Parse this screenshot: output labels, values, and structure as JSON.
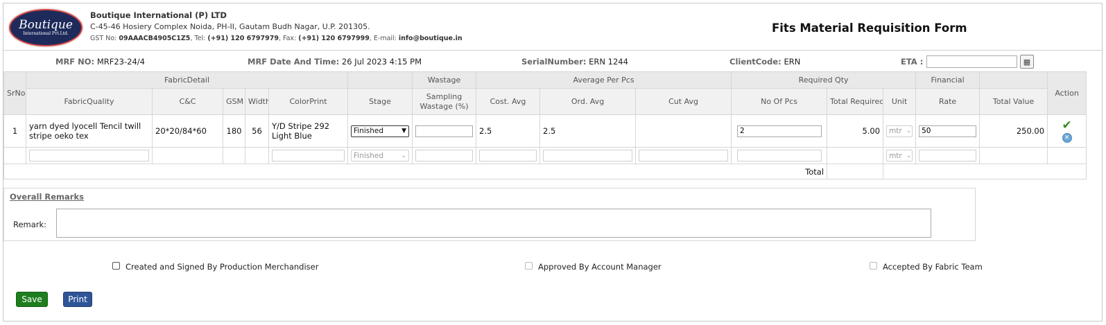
{
  "header": {
    "logo_text": "Boutique",
    "logo_subtext": "International Pvt.Ltd.",
    "company_name": "Boutique International (P) LTD",
    "address": "C-45-46 Hosiery Complex Noida, PH-II, Gautam Budh Nagar, U.P. 201305.",
    "gst_label": "GST No:",
    "gst_value": "09AAACB4905C1Z5",
    "tel_label": ", Tel:",
    "tel_value": "(+91) 120 6797979",
    "fax_label": ", Fax:",
    "fax_value": "(+91) 120 6797999",
    "email_label": ", E-mail:",
    "email_value": "info@boutique.in",
    "form_title": "Fits Material Requisition Form"
  },
  "meta": {
    "mrf_no_label": "MRF NO:",
    "mrf_no_value": "MRF23-24/4",
    "mrf_date_label": "MRF Date And Time:",
    "mrf_date_value": "26 Jul 2023 4:15 PM",
    "serial_label": "SerialNumber:",
    "serial_value": "ERN 1244",
    "client_label": "ClientCode:",
    "client_value": "ERN",
    "eta_label": "ETA :",
    "eta_value": ""
  },
  "table": {
    "group_headers": {
      "srno": "SrNo",
      "fabric_detail": "FabricDetail",
      "wastage": "Wastage",
      "average_per_pcs": "Average Per Pcs",
      "required_qty": "Required Qty",
      "financial": "Financial",
      "action": "Action"
    },
    "columns": {
      "fabric_quality": "FabricQuality",
      "cc": "C&C",
      "gsm": "GSM",
      "width": "Width",
      "color_print": "ColorPrint",
      "stage": "Stage",
      "sampling_wastage": "Sampling Wastage (%)",
      "cost_avg": "Cost. Avg",
      "ord_avg": "Ord. Avg",
      "cut_avg": "Cut Avg",
      "no_of_pcs": "No Of Pcs",
      "total_required": "Total Required",
      "unit": "Unit",
      "rate": "Rate",
      "total_value": "Total Value"
    },
    "row1": {
      "srno": "1",
      "fabric_quality": "yarn dyed lyocell Tencil twill stripe oeko tex",
      "cc": "20*20/84*60",
      "gsm": "180",
      "width": "56",
      "color_print": "Y/D Stripe 292 Light Blue",
      "stage": "Finished",
      "sampling_wastage": "",
      "cost_avg": "2.5",
      "ord_avg": "2.5",
      "cut_avg": "",
      "no_of_pcs": "2",
      "total_required": "5.00",
      "unit": "mtr",
      "rate": "50",
      "total_value": "250.00"
    },
    "row2": {
      "stage": "Finished",
      "unit": "mtr"
    },
    "total_label": "Total"
  },
  "remarks": {
    "title": "Overall Remarks",
    "remark_label": "Remark:",
    "remark_value": ""
  },
  "checkboxes": {
    "created": "Created and Signed By Production Merchandiser",
    "approved": "Approved By Account Manager",
    "accepted": "Accepted By Fabric Team"
  },
  "buttons": {
    "save": "Save",
    "print": "Print"
  },
  "colors": {
    "save_button": "#1e7e1e",
    "print_button": "#2f5597",
    "check_icon": "#3a8b1a",
    "header_group_bg": "#e9e9e9"
  },
  "icons": {
    "calendar": "calendar-icon",
    "approve": "check-icon",
    "remove": "remove-icon"
  }
}
